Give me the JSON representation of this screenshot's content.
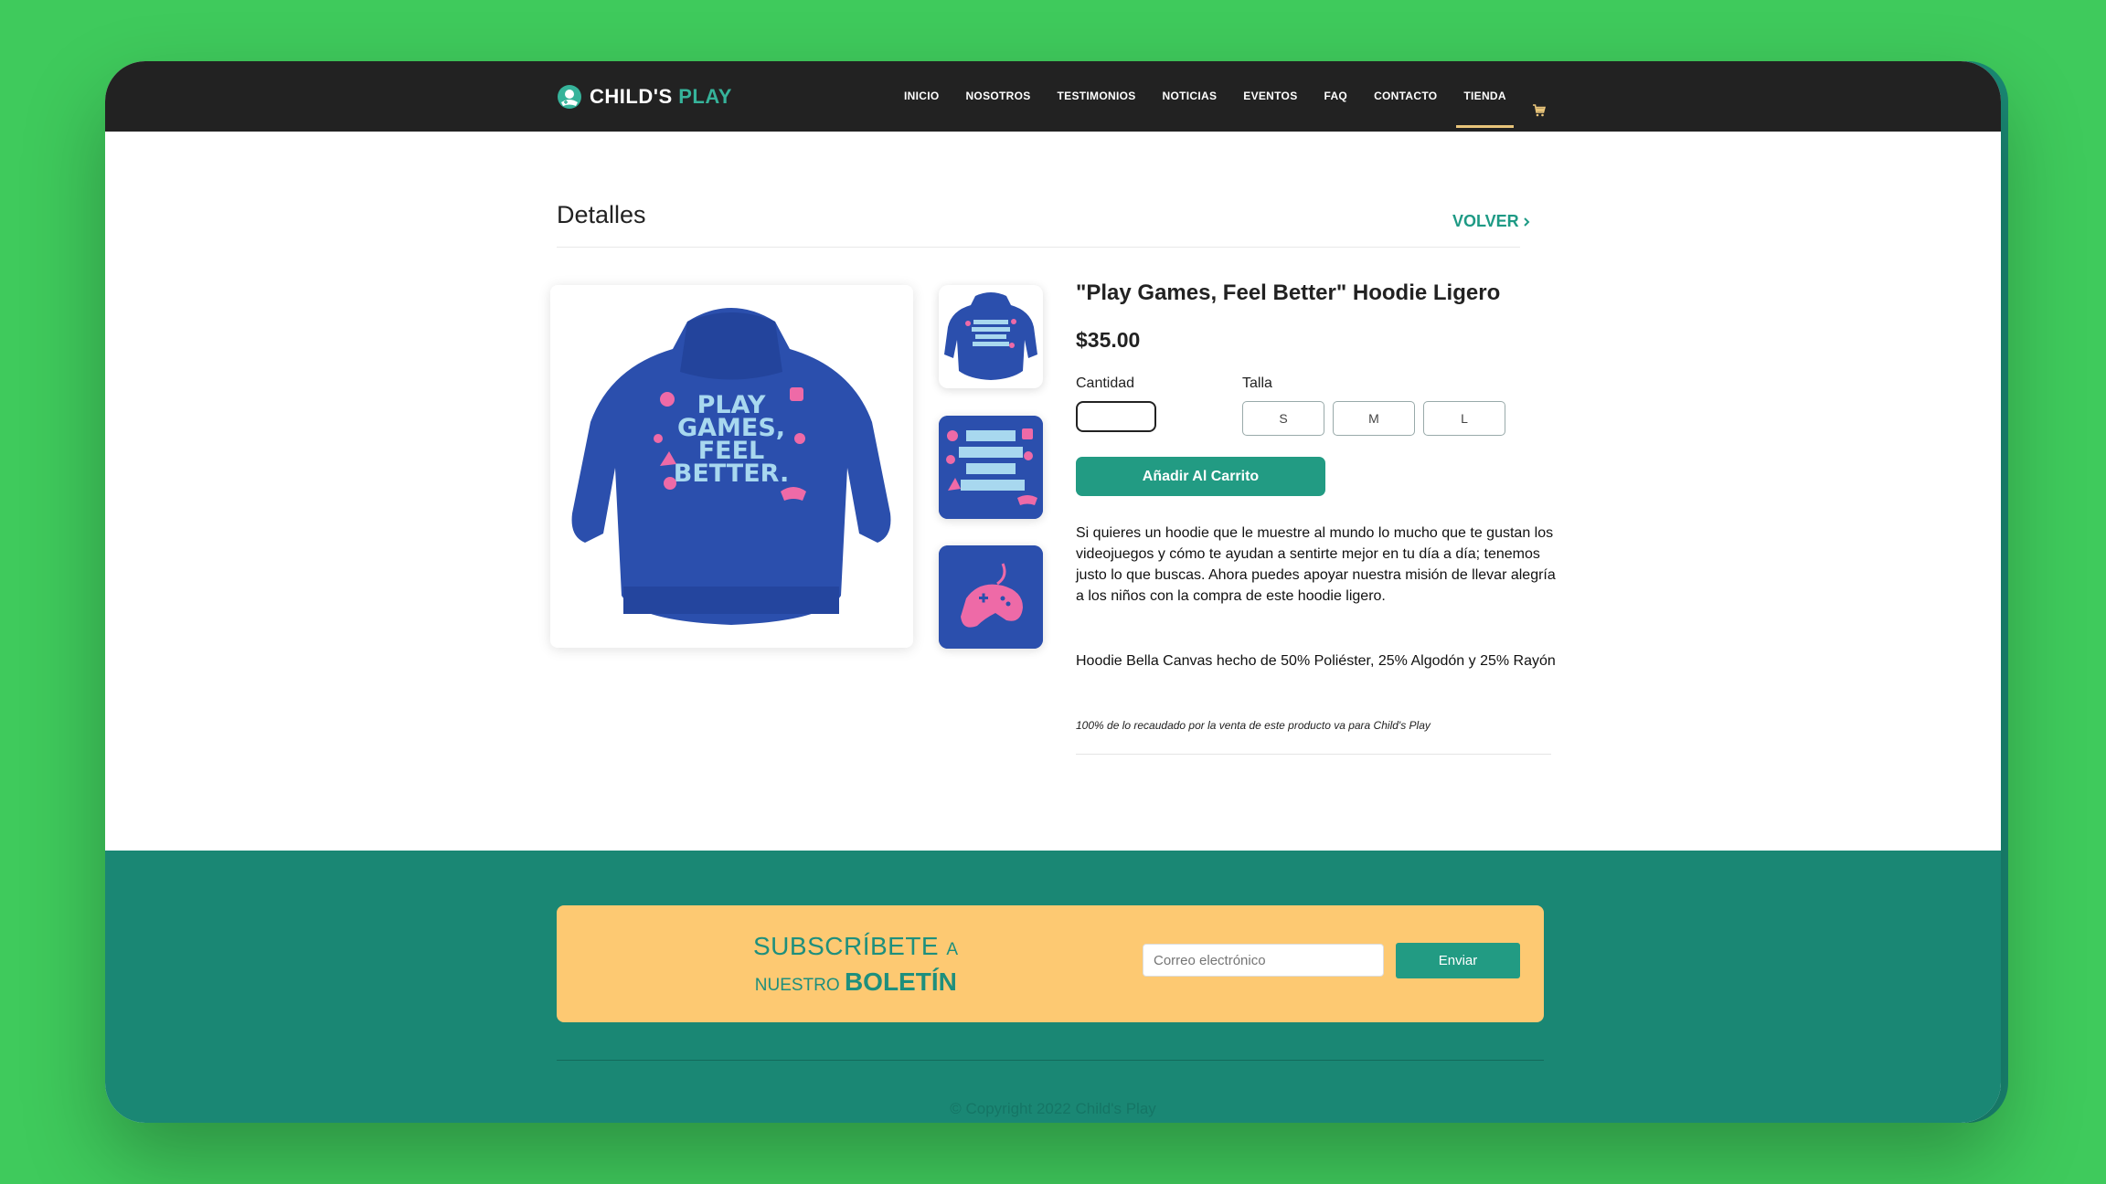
{
  "nav": {
    "logo_text_main": "CHILD'S",
    "logo_text_accent": "PLAY",
    "items": [
      "INICIO",
      "NOSOTROS",
      "TESTIMONIOS",
      "NOTICIAS",
      "EVENTOS",
      "FAQ",
      "CONTACTO",
      "TIENDA"
    ],
    "active_item": "TIENDA",
    "cart_icon": "cart-icon"
  },
  "details": {
    "title": "Detalles",
    "back_label": "VOLVER"
  },
  "product": {
    "name": "\"Play Games, Feel Better\" Hoodie Ligero",
    "price": "$35.00",
    "quantity_label": "Cantidad",
    "quantity_value": "",
    "size_label": "Talla",
    "sizes": [
      "S",
      "M",
      "L"
    ],
    "add_to_cart": "Añadir Al Carrito",
    "description": "Si quieres un hoodie que le muestre al mundo lo mucho que te gustan los videojuegos y cómo te ayudan a sentirte mejor en tu día a día; tenemos justo lo que buscas. Ahora puedes apoyar nuestra misión de llevar alegría a los niños con la compra de este hoodie ligero.",
    "material": "Hoodie Bella Canvas hecho de 50% Poliéster, 25% Algodón y 25% Rayón",
    "note": "100% de lo recaudado por la venta de este producto va para Child's Play",
    "print_text": [
      "PLAY",
      "GAMES,",
      "FEEL",
      "BETTER."
    ],
    "colors": {
      "hoodie": "#2b4fad",
      "print_text": "#a8d8ef",
      "print_pink": "#ee6aa7"
    }
  },
  "footer": {
    "subscribe_word": "SUBSCRÍBETE",
    "subscribe_a": "A",
    "subscribe_nuestro": "NUESTRO",
    "subscribe_boletin": "BOLETÍN",
    "email_placeholder": "Correo electrónico",
    "send_label": "Enviar",
    "copyright": "© Copyright 2022 Child's Play"
  },
  "colors": {
    "background": "#3fca5c",
    "nav": "#222222",
    "accent": "#229b83",
    "footer": "#1a8774",
    "subscribe_box": "#fdc972",
    "active_underline": "#e8c47a"
  }
}
